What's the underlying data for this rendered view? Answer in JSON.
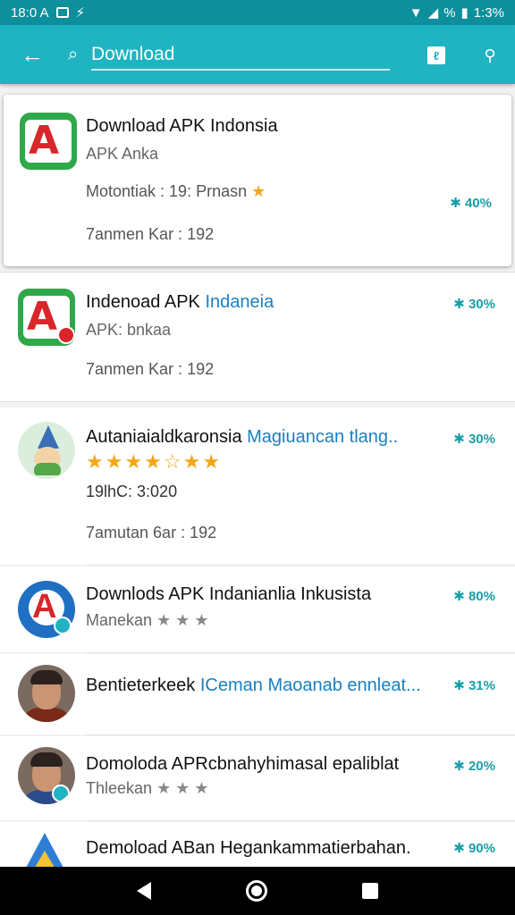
{
  "status_bar": {
    "time": "18:0 A",
    "battery": "% ",
    "clock": "1:3%"
  },
  "app_bar": {
    "search_query": "Download",
    "search_placeholder": "Download"
  },
  "results": [
    {
      "title": "Download APK Indonsia",
      "subtitle": "APK Anka",
      "meta1": "Motontiak : 19: Prnasn",
      "meta2": "7anmen Kar : 192",
      "percent": "40%"
    },
    {
      "title": "Indenoad APK",
      "title_highlight": "Indaneia",
      "subtitle": "APK: bnkaa",
      "meta2": "7anmen Kar : 192",
      "percent": "30%"
    },
    {
      "title": "Autaniaialdkaronsia",
      "title_highlight": "Magiuancan tlang..",
      "meta1": "19lhC: 3:020",
      "meta2": "7amutan 6ar : 192",
      "percent": "30%",
      "rating_stars": "★★★★☆★★"
    },
    {
      "title": "Downlods APK Indanianlia Inkusista",
      "subtitle": "Manekan",
      "percent": "80%",
      "rating_stars": "★ ★ ★"
    },
    {
      "title": "Bentieterkeek",
      "title_highlight": "ICeman Maoanab ennleat...",
      "percent": "31%"
    },
    {
      "title": "Domoloda APRcbnahyhimasal epaliblat",
      "subtitle": "Thleekan",
      "percent": "20%",
      "rating_stars": "★ ★ ★"
    },
    {
      "title": "Demoload ABan Hegankammatierbahan.",
      "percent": "90%"
    }
  ],
  "colors": {
    "appbar": "#20b3c2",
    "statusbar": "#0d8f9c",
    "percent": "#1a9ea8",
    "star": "#f2a71b"
  },
  "icons": [
    "back-arrow-icon",
    "search-icon",
    "bookmark-icon",
    "share-icon"
  ]
}
